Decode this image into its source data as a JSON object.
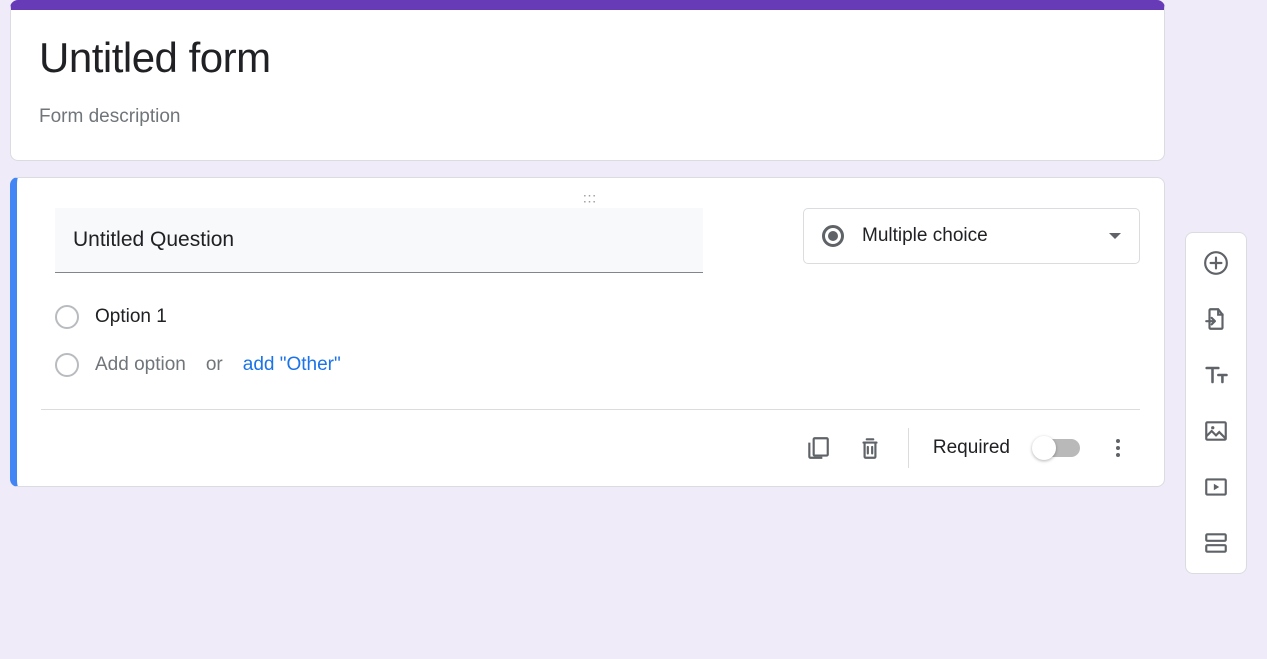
{
  "header": {
    "title": "Untitled form",
    "description_placeholder": "Form description"
  },
  "question": {
    "title": "Untitled Question",
    "type_label": "Multiple choice",
    "options": [
      {
        "label": "Option 1"
      }
    ],
    "add_option_text": "Add option",
    "or_text": "or",
    "add_other_text": "add \"Other\""
  },
  "footer": {
    "required_label": "Required",
    "required_value": false
  },
  "toolbar": {
    "add_question": "Add question",
    "import_questions": "Import questions",
    "add_title": "Add title and description",
    "add_image": "Add image",
    "add_video": "Add video",
    "add_section": "Add section"
  }
}
